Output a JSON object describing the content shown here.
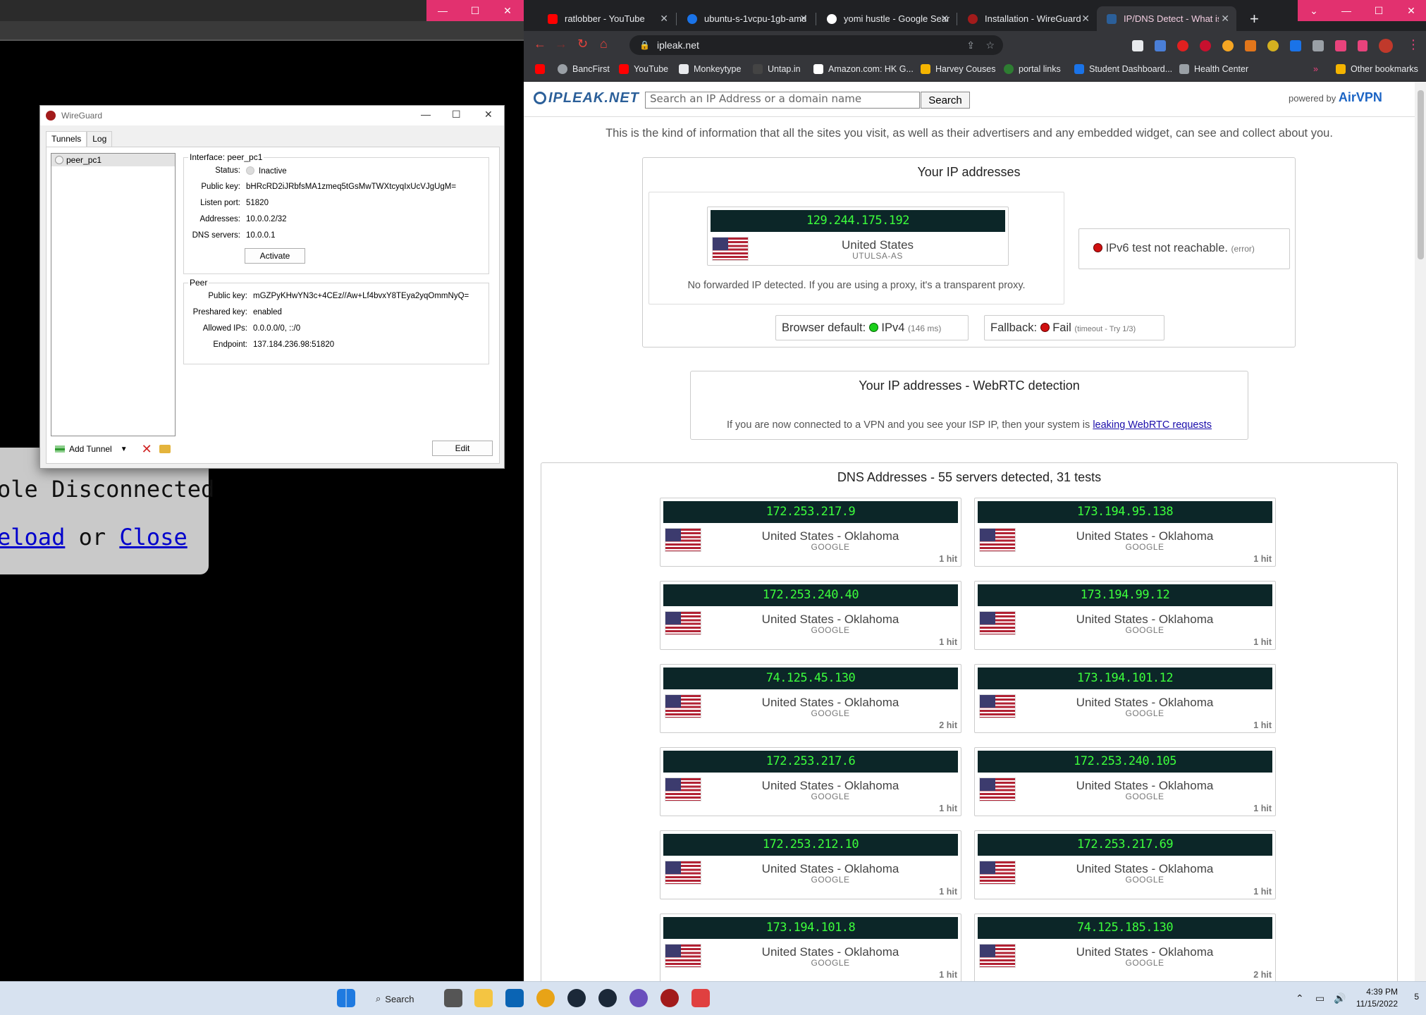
{
  "console": {
    "disconnected_text": "ole Disconnected",
    "reload_text": "eload",
    "or_text": " or ",
    "close_text": "Close",
    "min_label": "—",
    "max_label": "☐",
    "close_label": "✕"
  },
  "wireguard": {
    "title": "WireGuard",
    "tabs": [
      "Tunnels",
      "Log"
    ],
    "tunnels": [
      "peer_pc1"
    ],
    "interface": {
      "legend": "Interface: peer_pc1",
      "fields": [
        {
          "k": "Status:",
          "v": "Inactive"
        },
        {
          "k": "Public key:",
          "v": "bHRcRD2iJRbfsMA1zmeq5tGsMwTWXtcyqIxUcVJgUgM="
        },
        {
          "k": "Listen port:",
          "v": "51820"
        },
        {
          "k": "Addresses:",
          "v": "10.0.0.2/32"
        },
        {
          "k": "DNS servers:",
          "v": "10.0.0.1"
        }
      ],
      "activate_label": "Activate"
    },
    "peer": {
      "legend": "Peer",
      "fields": [
        {
          "k": "Public key:",
          "v": "mGZPyKHwYN3c+4CEz//Aw+Lf4bvxY8TEya2yqOmmNyQ="
        },
        {
          "k": "Preshared key:",
          "v": "enabled"
        },
        {
          "k": "Allowed IPs:",
          "v": "0.0.0.0/0, ::/0"
        },
        {
          "k": "Endpoint:",
          "v": "137.184.236.98:51820"
        }
      ]
    },
    "add_tunnel_label": "Add Tunnel",
    "edit_label": "Edit"
  },
  "chrome": {
    "tabs": [
      {
        "label": "ratlobber - YouTube",
        "color": "#ff0000"
      },
      {
        "label": "ubuntu-s-1vcpu-1gb-amd",
        "color": "#1a73e8"
      },
      {
        "label": "yomi hustle - Google Search",
        "color": "#ffffff"
      },
      {
        "label": "Installation - WireGuard",
        "color": "#a21b1b"
      },
      {
        "label": "IP/DNS Detect - What is your IP",
        "color": "#2b5f99"
      }
    ],
    "url": "ipleak.net",
    "bookmarks": [
      {
        "label": "",
        "color": "#ff0000"
      },
      {
        "label": "BancFirst",
        "color": "#9aa0a6"
      },
      {
        "label": "YouTube",
        "color": "#ff0000"
      },
      {
        "label": "Monkeytype",
        "color": "#e2b714"
      },
      {
        "label": "Untap.in",
        "color": "#444"
      },
      {
        "label": "Amazon.com: HK G...",
        "color": "#ff9900"
      },
      {
        "label": "Harvey Couses",
        "color": "#f4b400"
      },
      {
        "label": "portal links",
        "color": "#2e7d32"
      },
      {
        "label": "Student Dashboard...",
        "color": "#1a73e8"
      },
      {
        "label": "Health Center",
        "color": "#9aa0a6"
      }
    ],
    "other_bookmarks": "Other bookmarks",
    "more_chevron": "»"
  },
  "site": {
    "logo": "IPLEAK.NET",
    "search_placeholder": "Search an IP Address or a domain name",
    "search_button": "Search",
    "powered_by": "powered by",
    "powered_brand": "AirVPN",
    "intro": "This is the kind of information that all the sites you visit, as well as their advertisers and any embedded widget, can see and collect about you.",
    "ip_title": "Your IP addresses",
    "main_ip": "129.244.175.192",
    "main_country": "United States",
    "main_isp": "UTULSA-AS",
    "no_forward": "No forwarded IP detected. If you are using a proxy, it's a transparent proxy.",
    "ipv6_text": "IPv6 test not reachable.",
    "ipv6_err": "(error)",
    "browser_default_label": "Browser default:",
    "browser_default_value": "IPv4",
    "browser_default_ms": "(146 ms)",
    "fallback_label": "Fallback:",
    "fallback_value": "Fail",
    "fallback_note": "(timeout - Try 1/3)",
    "webrtc_title": "Your IP addresses - WebRTC detection",
    "webrtc_text": "If you are now connected to a VPN and you see your ISP IP, then your system is",
    "webrtc_link": "leaking WebRTC requests",
    "dns_title": "DNS Addresses - 55 servers detected, 31 tests",
    "dns": [
      {
        "ip": "172.253.217.9",
        "place": "United States - Oklahoma",
        "isp": "GOOGLE",
        "hits": "1 hit"
      },
      {
        "ip": "173.194.95.138",
        "place": "United States - Oklahoma",
        "isp": "GOOGLE",
        "hits": "1 hit"
      },
      {
        "ip": "172.253.240.40",
        "place": "United States - Oklahoma",
        "isp": "GOOGLE",
        "hits": "1 hit"
      },
      {
        "ip": "173.194.99.12",
        "place": "United States - Oklahoma",
        "isp": "GOOGLE",
        "hits": "1 hit"
      },
      {
        "ip": "74.125.45.130",
        "place": "United States - Oklahoma",
        "isp": "GOOGLE",
        "hits": "2 hit"
      },
      {
        "ip": "173.194.101.12",
        "place": "United States - Oklahoma",
        "isp": "GOOGLE",
        "hits": "1 hit"
      },
      {
        "ip": "172.253.217.6",
        "place": "United States - Oklahoma",
        "isp": "GOOGLE",
        "hits": "1 hit"
      },
      {
        "ip": "172.253.240.105",
        "place": "United States - Oklahoma",
        "isp": "GOOGLE",
        "hits": "1 hit"
      },
      {
        "ip": "172.253.212.10",
        "place": "United States - Oklahoma",
        "isp": "GOOGLE",
        "hits": "1 hit"
      },
      {
        "ip": "172.253.217.69",
        "place": "United States - Oklahoma",
        "isp": "GOOGLE",
        "hits": "1 hit"
      },
      {
        "ip": "173.194.101.8",
        "place": "United States - Oklahoma",
        "isp": "GOOGLE",
        "hits": "1 hit"
      },
      {
        "ip": "74.125.185.130",
        "place": "United States - Oklahoma",
        "isp": "GOOGLE",
        "hits": "2 hit"
      }
    ]
  },
  "taskbar": {
    "search_label": "Search",
    "time": "4:39 PM",
    "date": "11/15/2022",
    "notif_count": "5"
  }
}
